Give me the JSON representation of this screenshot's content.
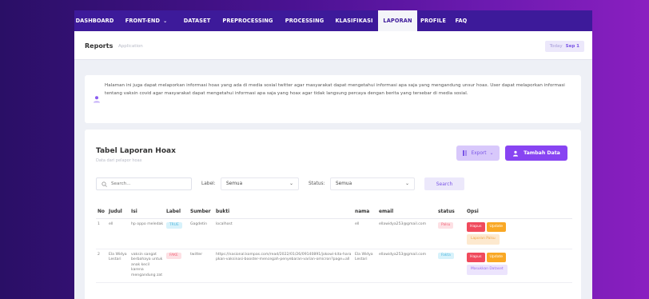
{
  "nav": [
    {
      "label": "DASHBOARD",
      "caret": false,
      "active": false
    },
    {
      "label": "FRONT-END",
      "caret": true,
      "active": false
    },
    {
      "label": "DATASET",
      "caret": false,
      "active": false
    },
    {
      "label": "PREPROCESSING",
      "caret": false,
      "active": false
    },
    {
      "label": "PROCESSING",
      "caret": false,
      "active": false
    },
    {
      "label": "KLASIFIKASI",
      "caret": false,
      "active": false
    },
    {
      "label": "LAPORAN",
      "caret": false,
      "active": true
    },
    {
      "label": "PROFILE",
      "caret": false,
      "active": false
    },
    {
      "label": "FAQ",
      "caret": false,
      "active": false
    }
  ],
  "header": {
    "title": "Reports",
    "subtitle": "Application",
    "today_label": "Today",
    "date": "Sep 1"
  },
  "info": {
    "text": "Halaman ini juga dapat melaporkan informasi hoax yang ada di media sosial twitter agar masyarakat dapat mengetahui informasi apa saja yang mengandung unsur hoax. User dapat melaporkan informasi tentang vaksin covid agar masyarakat dapat mengetahui informasi apa saja yang hoax agar tidak langsung percaya dengan berita yang tersebar di media sosial."
  },
  "card": {
    "title": "Tabel Laporan Hoax",
    "subtitle": "Data dari pelapor hoax",
    "export_label": "Export",
    "add_label": "Tambah Data"
  },
  "filters": {
    "search_placeholder": "Search...",
    "label_text": "Label:",
    "label_value": "Semua",
    "status_text": "Status:",
    "status_value": "Semua",
    "search_button": "Search"
  },
  "table": {
    "headers": [
      "No",
      "Judul",
      "Isi",
      "Label",
      "Sumber",
      "bukti",
      "nama",
      "email",
      "status",
      "Opsi"
    ],
    "rows": [
      {
        "no": "1",
        "judul": "ell",
        "isi": "hp oppo meledak",
        "label": "TRUE",
        "label_kind": "true",
        "sumber": "Gagdetin",
        "bukti": "localhost",
        "nama": "ell",
        "email": "ellawidya253@gmail.com",
        "status": "Palsu",
        "status_kind": "palsu",
        "actions": [
          "Hapus",
          "Update"
        ],
        "extra_action": "Laporan Palsu",
        "extra_kind": "orange"
      },
      {
        "no": "2",
        "judul": "Ela Widya Lestari",
        "isi": "vaksin sangat berbahaya untuk anak kecil karena mengandung zat",
        "label": "FAKE",
        "label_kind": "fake",
        "sumber": "twitter",
        "bukti": "https://nasional.kompas.com/read/2022/01/26/09140891/jokowi-kita-harapkan-vaksinasi-booster-mencegah-penyebaran-varian-omicron?page=all",
        "nama": "Ela Widya Lestari",
        "email": "ellawidya253@gmail.com",
        "status": "Fakta",
        "status_kind": "fakta",
        "actions": [
          "Hapus",
          "Update"
        ],
        "extra_action": "Masukkan Dataset",
        "extra_kind": "purple"
      }
    ]
  }
}
